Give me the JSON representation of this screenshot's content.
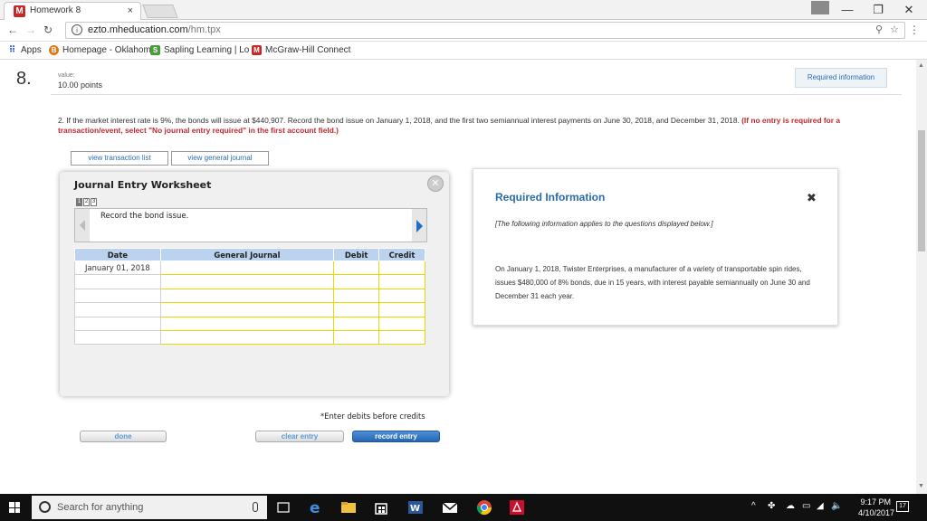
{
  "browser": {
    "tab_title": "Homework 8",
    "tab_favicon": "M",
    "tab_close": "×",
    "url_host": "ezto.mheducation.com",
    "url_path": "/hm.tpx",
    "win_min": "—",
    "win_max": "❐",
    "win_close": "✕"
  },
  "bookmarks": [
    {
      "label": "Apps",
      "icon": "apps-grid-icon"
    },
    {
      "label": "Homepage - Oklahom",
      "icon": "oklahoma-b-icon"
    },
    {
      "label": "Sapling Learning | Lo",
      "icon": "sapling-icon"
    },
    {
      "label": "McGraw-Hill Connect",
      "icon": "mcgraw-hill-icon"
    }
  ],
  "question": {
    "number": "8.",
    "value_label": "value:",
    "points": "10.00 points",
    "required_info_button": "Required information",
    "text": "2. If the market interest rate is 9%, the bonds will issue at $440,907. Record the bond issue on January 1, 2018, and the first two semiannual interest payments on June 30, 2018, and December 31, 2018.",
    "instruction": "(If no entry is required for a transaction/event, select \"No journal entry required\" in the first account field.)"
  },
  "view_buttons": {
    "transaction_list": "view transaction list",
    "general_journal": "view general journal"
  },
  "worksheet": {
    "title": "Journal Entry Worksheet",
    "pages": [
      "1",
      "2",
      "3"
    ],
    "description": "Record the bond issue.",
    "columns": [
      "Date",
      "General Journal",
      "Debit",
      "Credit"
    ],
    "rows": [
      {
        "date": "January 01, 2018"
      },
      {
        "date": ""
      },
      {
        "date": ""
      },
      {
        "date": ""
      },
      {
        "date": ""
      },
      {
        "date": ""
      }
    ],
    "note": "*Enter debits before credits",
    "buttons": {
      "done": "done",
      "clear": "clear entry",
      "record": "record entry"
    }
  },
  "required_info": {
    "title": "Required Information",
    "close": "✖",
    "italic_note": "[The following information applies to the questions displayed below.]",
    "body": "On January 1, 2018, Twister Enterprises, a manufacturer of a variety of transportable spin rides, issues $480,000 of 8% bonds, due in 15 years, with interest payable semiannually on June 30 and December 31 each year."
  },
  "taskbar": {
    "search_placeholder": "Search for anything",
    "time": "9:17 PM",
    "date": "4/10/2017",
    "notification_count": "17"
  },
  "colors": {
    "accent_blue": "#2a6ba8",
    "required_red": "#c0282d",
    "table_header": "#bcd3ef",
    "input_yellow": "#e6d900"
  }
}
